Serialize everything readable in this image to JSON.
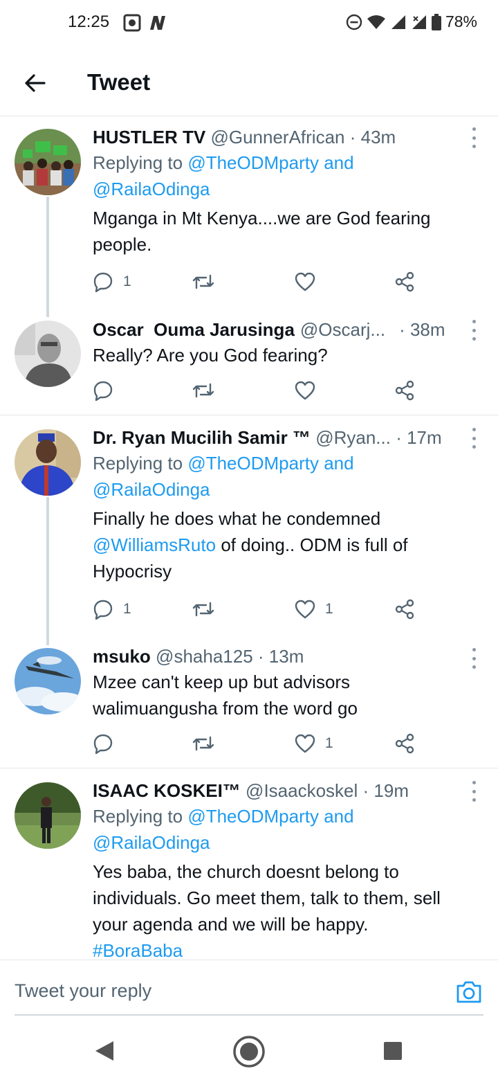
{
  "status_bar": {
    "time": "12:25",
    "battery": "78%"
  },
  "header": {
    "title": "Tweet"
  },
  "tweets": [
    {
      "name": "HUSTLER TV",
      "handle": "@GunnerAfrican",
      "time": "· 43m",
      "replying_prefix": "Replying to",
      "replying_to_1": "@TheODMparty",
      "replying_and": "and",
      "replying_to_2": "@RailaOdinga",
      "text": "Mganga in Mt Kenya....we are God fearing people.",
      "reply_count": "1",
      "retweet_count": "",
      "like_count": ""
    },
    {
      "name": "Oscar  Ouma Jarusinga",
      "handle": "@Oscarj...",
      "time": "· 38m",
      "text": "Really? Are you God fearing?",
      "reply_count": "",
      "retweet_count": "",
      "like_count": ""
    },
    {
      "name": "Dr. Ryan Mucilih Samir ™",
      "handle": "@Ryan...",
      "time": "· 17m",
      "replying_prefix": "Replying to",
      "replying_to_1": "@TheODMparty",
      "replying_and": "and",
      "replying_to_2": "@RailaOdinga",
      "text_part1": "Finally he does what he condemned",
      "text_mention": "@WilliamsRuto",
      "text_part2": "of doing.. ODM is full of Hypocrisy",
      "reply_count": "1",
      "retweet_count": "",
      "like_count": "1"
    },
    {
      "name": "msuko",
      "handle": "@shaha125",
      "time": "· 13m",
      "text": "Mzee can't keep up but advisors walimuangusha from the word go",
      "reply_count": "",
      "retweet_count": "",
      "like_count": "1"
    },
    {
      "name": "ISAAC KOSKEI™",
      "handle": "@Isaackoskel",
      "time": "· 19m",
      "replying_prefix": "Replying to",
      "replying_to_1": "@TheODMparty",
      "replying_and": "and",
      "replying_to_2": "@RailaOdinga",
      "text": "Yes baba, the church doesnt belong to individuals. Go meet them, talk to them, sell your agenda and we will be happy.",
      "hashtag": "#BoraBaba"
    }
  ],
  "reply_bar": {
    "placeholder": "Tweet your reply"
  },
  "colors": {
    "link": "#1d9bf0",
    "text": "#0f1419",
    "muted": "#536471",
    "divider": "#e4e6e8"
  }
}
